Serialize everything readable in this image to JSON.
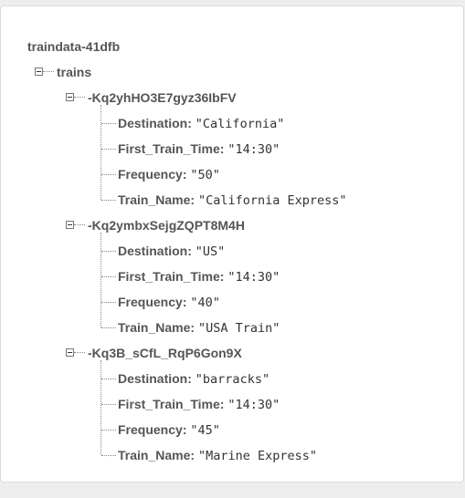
{
  "root": {
    "label": "traindata-41dfb"
  },
  "trains": {
    "label": "trains",
    "children": [
      {
        "key": "-Kq2yhHO3E7gyz36IbFV",
        "fields": [
          {
            "name": "Destination",
            "value": "\"California\""
          },
          {
            "name": "First_Train_Time",
            "value": "\"14:30\""
          },
          {
            "name": "Frequency",
            "value": "\"50\""
          },
          {
            "name": "Train_Name",
            "value": "\"California Express\""
          }
        ]
      },
      {
        "key": "-Kq2ymbxSejgZQPT8M4H",
        "fields": [
          {
            "name": "Destination",
            "value": "\"US\""
          },
          {
            "name": "First_Train_Time",
            "value": "\"14:30\""
          },
          {
            "name": "Frequency",
            "value": "\"40\""
          },
          {
            "name": "Train_Name",
            "value": "\"USA Train\""
          }
        ]
      },
      {
        "key": "-Kq3B_sCfL_RqP6Gon9X",
        "fields": [
          {
            "name": "Destination",
            "value": "\"barracks\""
          },
          {
            "name": "First_Train_Time",
            "value": "\"14:30\""
          },
          {
            "name": "Frequency",
            "value": "\"45\""
          },
          {
            "name": "Train_Name",
            "value": "\"Marine Express\""
          }
        ]
      }
    ]
  },
  "separator": ":"
}
